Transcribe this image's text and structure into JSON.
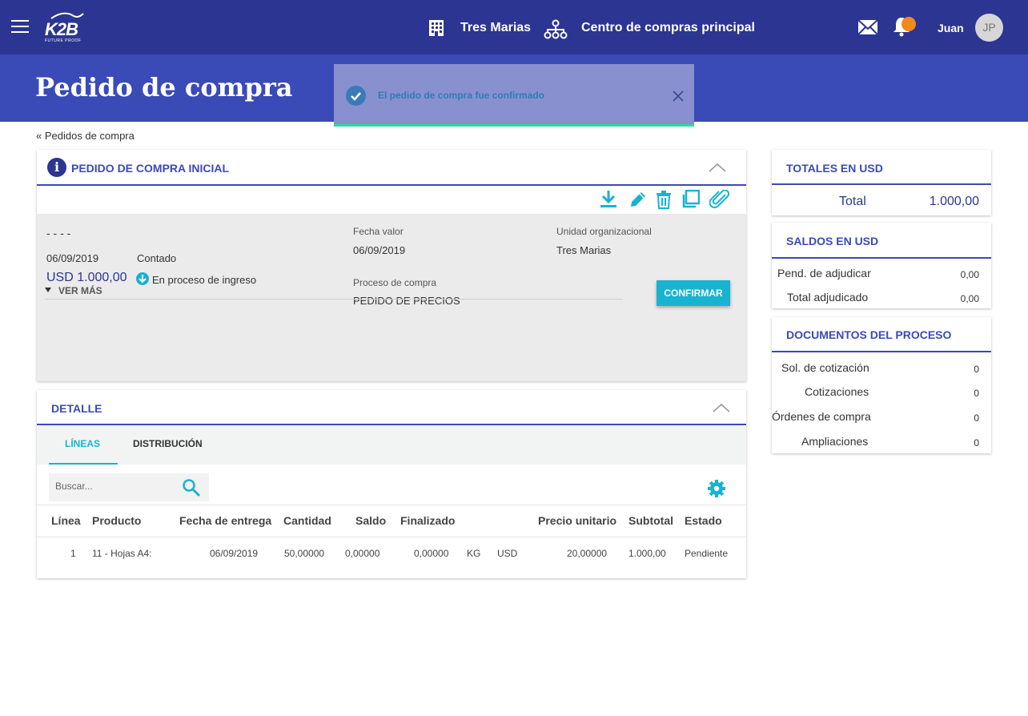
{
  "header": {
    "logo_text": "K2B",
    "logo_tagline": "FUTURE PROOF",
    "organization": "Tres Marias",
    "purchase_center": "Centro de compras principal",
    "user_name": "Juan",
    "user_initials": "JP",
    "colors": {
      "bar": "#2c3591",
      "title_bar": "#3a4ab7",
      "notification": "#f08a1c"
    },
    "icons": [
      "menu-icon",
      "building-icon",
      "org-chart-icon",
      "mail-icon",
      "bell-icon"
    ]
  },
  "page": {
    "title": "Pedido de compra"
  },
  "toast": {
    "message": "El pedido de compra fue confirmado"
  },
  "breadcrumb": {
    "label": "« Pedidos de compra"
  },
  "order": {
    "section_title": "PEDIDO DE COMPRA INICIAL",
    "toolbar_icons": [
      "download-icon",
      "edit-icon",
      "delete-icon",
      "copy-icon",
      "attach-icon"
    ],
    "number": "- - - -",
    "date": "06/09/2019",
    "payment": "Contado",
    "amount": "USD 1.000,00",
    "status": "En proceso de ingreso",
    "value_date_label": "Fecha valor",
    "value_date": "06/09/2019",
    "org_unit_label": "Unidad organizacional",
    "org_unit": "Tres Marias",
    "process_label": "Proceso de compra",
    "process": "PEDIDO DE PRECIOS",
    "see_more": "VER MÁS",
    "confirm_label": "CONFIRMAR",
    "accent_color": "#18b3cf"
  },
  "detail": {
    "section_title": "DETALLE",
    "tabs": [
      {
        "label": "LÍNEAS",
        "active": true
      },
      {
        "label": "DISTRIBUCIÓN",
        "active": false
      }
    ],
    "search_placeholder": "Buscar...",
    "columns": [
      "Línea",
      "Producto",
      "Fecha de entrega",
      "Cantidad",
      "Saldo",
      "Finalizado",
      "Precio unitario",
      "Subtotal",
      "Estado"
    ],
    "rows": [
      {
        "line": "1",
        "product": "11 - Hojas A4:",
        "delivery_date": "06/09/2019",
        "quantity": "50,00000",
        "balance": "0,00000",
        "finished": "0,00000",
        "unit": "KG",
        "currency": "USD",
        "unit_price": "20,00000",
        "subtotal": "1.000,00",
        "status": "Pendiente"
      }
    ]
  },
  "totals": {
    "title": "TOTALES EN USD",
    "total_label": "Total",
    "total_value": "1.000,00"
  },
  "balances": {
    "title": "SALDOS EN USD",
    "items": [
      {
        "label": "Pend. de adjudicar",
        "value": "0,00"
      },
      {
        "label": "Total adjudicado",
        "value": "0,00"
      }
    ]
  },
  "documents": {
    "title": "DOCUMENTOS DEL PROCESO",
    "items": [
      {
        "label": "Sol. de cotización",
        "value": "0"
      },
      {
        "label": "Cotizaciones",
        "value": "0"
      },
      {
        "label": "Órdenes de compra",
        "value": "0"
      },
      {
        "label": "Ampliaciones",
        "value": "0"
      }
    ]
  }
}
